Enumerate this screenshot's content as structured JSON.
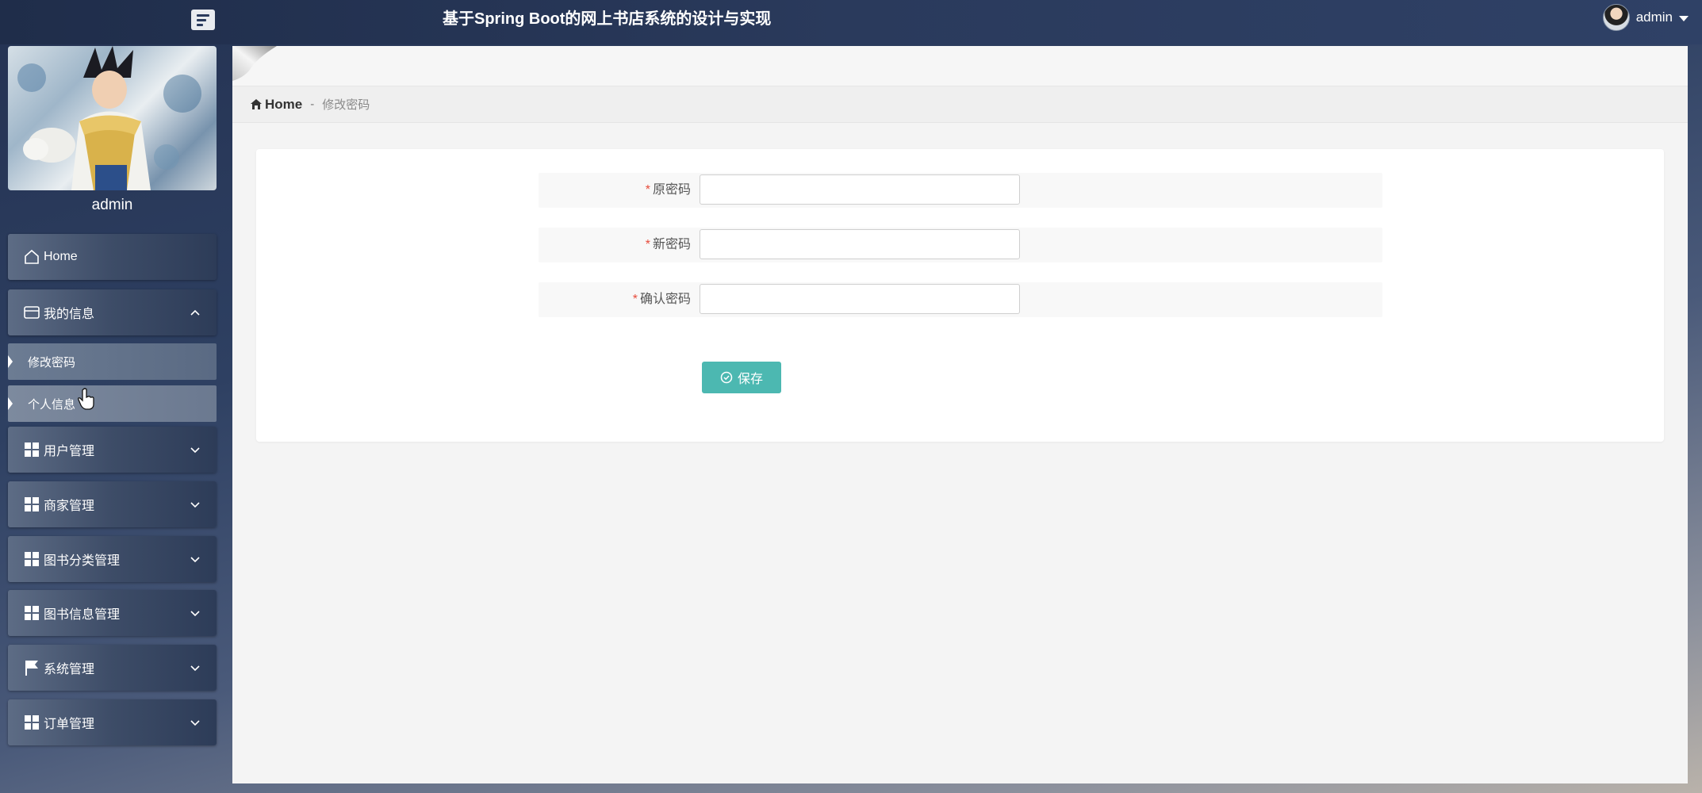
{
  "header": {
    "title": "基于Spring Boot的网上书店系统的设计与实现",
    "user_name": "admin"
  },
  "sidebar": {
    "profile_name": "admin",
    "items": [
      {
        "label": "Home",
        "icon": "home-icon"
      },
      {
        "label": "我的信息",
        "icon": "card-icon",
        "expanded": true,
        "children": [
          {
            "label": "修改密码",
            "active": true
          },
          {
            "label": "个人信息"
          }
        ]
      },
      {
        "label": "用户管理",
        "icon": "grid-icon"
      },
      {
        "label": "商家管理",
        "icon": "grid-icon"
      },
      {
        "label": "图书分类管理",
        "icon": "grid-icon"
      },
      {
        "label": "图书信息管理",
        "icon": "grid-icon"
      },
      {
        "label": "系统管理",
        "icon": "flag-icon"
      },
      {
        "label": "订单管理",
        "icon": "grid-icon"
      }
    ]
  },
  "breadcrumb": {
    "home": "Home",
    "separator": "-",
    "current": "修改密码"
  },
  "form": {
    "required_mark": "*",
    "fields": [
      {
        "label": "原密码",
        "value": "",
        "placeholder": ""
      },
      {
        "label": "新密码",
        "value": "",
        "placeholder": ""
      },
      {
        "label": "确认密码",
        "value": "",
        "placeholder": ""
      }
    ],
    "save_label": "保存"
  },
  "colors": {
    "accent": "#4cb8b1",
    "required": "#e74c3c",
    "topbar": "#2a3a5c"
  }
}
